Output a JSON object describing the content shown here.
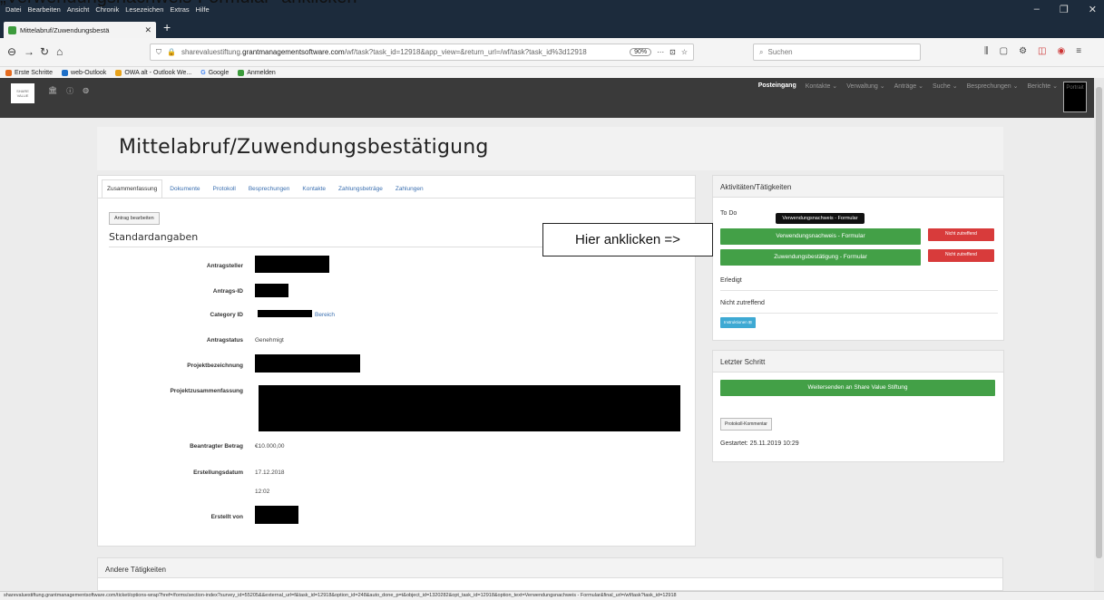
{
  "caption": "„Verwendungsnachweis-Formular“ anklicken",
  "browser": {
    "menus": [
      "Datei",
      "Bearbeiten",
      "Ansicht",
      "Chronik",
      "Lesezeichen",
      "Extras",
      "Hilfe"
    ],
    "tab_title": "Mittelabruf/Zuwendungsbestä",
    "url_prefix": "sharevaluestiftung.",
    "url_domain": "grantmanagementsoftware.com",
    "url_path": "/wf/task?task_id=12918&app_view=&return_url=/wf/task?task_id%3d12918",
    "zoom": "90%",
    "search_placeholder": "Suchen",
    "bookmarks": [
      "Erste Schritte",
      "web-Outlook",
      "OWA alt - Outlook We...",
      "Google",
      "Anmelden"
    ]
  },
  "app": {
    "logo_text": "SHARE VALUE",
    "nav": [
      "Posteingang",
      "Kontakte ⌄",
      "Verwaltung ⌄",
      "Anträge ⌄",
      "Suche ⌄",
      "Besprechungen ⌄",
      "Berichte ⌄"
    ],
    "portrait_label": "Portrait"
  },
  "page": {
    "title": "Mittelabruf/Zuwendungsbestätigung",
    "tabs": [
      "Zusammenfassung",
      "Dokumente",
      "Protokoll",
      "Besprechungen",
      "Kontakte",
      "Zahlungsbeträge",
      "Zahlungen"
    ],
    "edit_button": "Antrag bearbeiten",
    "section_title": "Standardangaben",
    "fields": {
      "antragsteller": "Antragsteller",
      "antrags_id": "Antrags-ID",
      "category_id": "Category ID",
      "category_link": "Bereich",
      "antragstatus": "Antragstatus",
      "antragstatus_value": "Genehmigt",
      "projektbezeichnung": "Projektbezeichnung",
      "projektzusammenfassung": "Projektzusammenfassung",
      "beantragter_betrag": "Beantragter Betrag",
      "beantragter_betrag_value": "€10.000,00",
      "erstellungsdatum": "Erstellungsdatum",
      "erstellungsdatum_value": "17.12.2018",
      "erstellungszeit_value": "12:02",
      "erstellt_von": "Erstellt von"
    }
  },
  "activities": {
    "title": "Aktivitäten/Tätigkeiten",
    "todo_label": "To Do",
    "tooltip": "Verwendungsnachweis - Formular",
    "btn1": "Verwendungsnachweis - Formular",
    "btn2": "Zuwendungsbestätigung - Formular",
    "not_applicable": "Nicht zutreffend",
    "done_label": "Erledigt",
    "not_applicable_label": "Nicht zutreffend",
    "instructions": "Instruktionen ⊞"
  },
  "last_step": {
    "title": "Letzter Schritt",
    "forward_button": "Weitersenden an Share Value Stiftung",
    "comment_button": "Protokoll-Kommentar",
    "started": "Gestartet: 25.11.2019 10:29"
  },
  "callout": "Hier anklicken =>",
  "other_activities": "Andere Tätigkeiten",
  "status_url": "sharevaluestiftung.grantmanagementsoftware.com/ticket/options-wrap?href=/forms/section-index?survey_id=55205&&external_url=f&task_id=12918&option_id=248&auto_done_p=t&object_id=1320282&opt_task_id=12918&option_text=Verwendungsnachweis - Formular&final_url=/wf/task?task_id=12918"
}
